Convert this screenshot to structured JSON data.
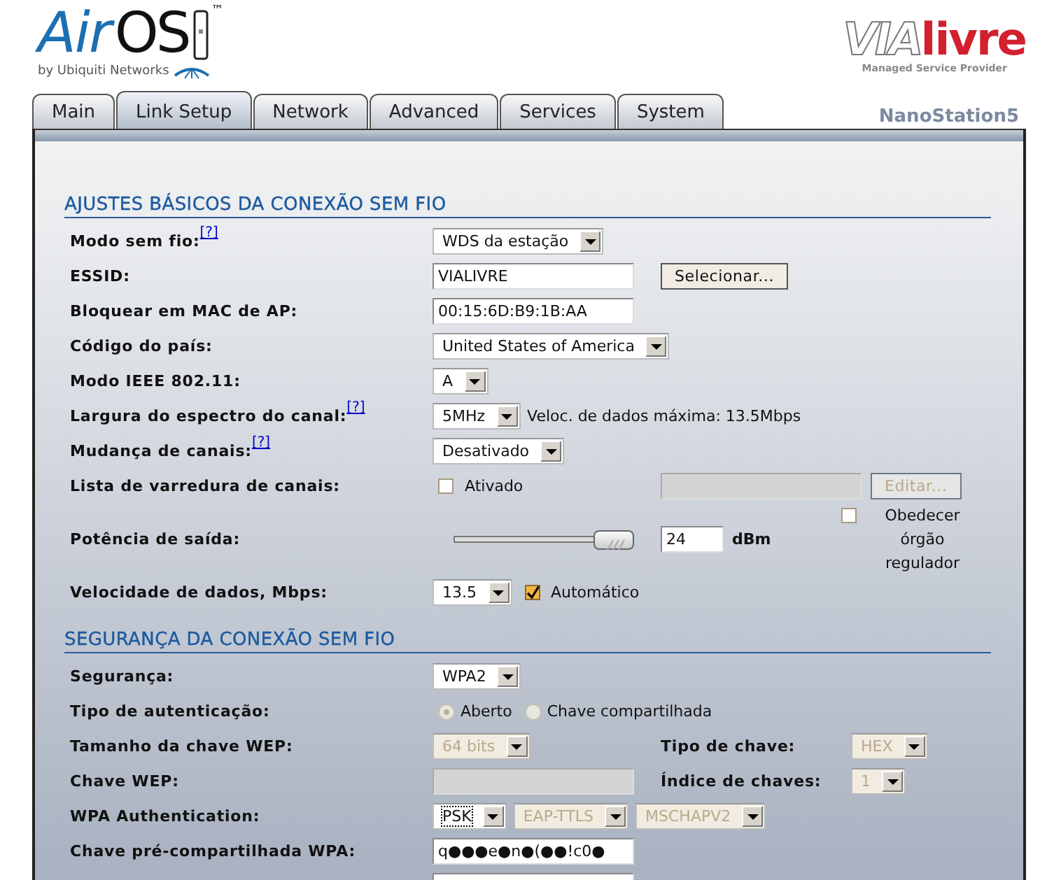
{
  "header": {
    "product_logo": {
      "name_a": "Air",
      "name_b": "OS",
      "trademark": "™",
      "tagline": "by Ubiquiti Networks"
    },
    "provider_logo": {
      "name_a": "VIA",
      "name_b": "livre",
      "tagline": "Managed Service Provider"
    }
  },
  "tabs": [
    {
      "label": "Main",
      "selected": false
    },
    {
      "label": "Link Setup",
      "selected": true
    },
    {
      "label": "Network",
      "selected": false
    },
    {
      "label": "Advanced",
      "selected": false
    },
    {
      "label": "Services",
      "selected": false
    },
    {
      "label": "System",
      "selected": false
    }
  ],
  "device_name": "NanoStation5",
  "sections": [
    {
      "title": "AJUSTES BÁSICOS DA CONEXÃO SEM FIO",
      "rows": [
        {
          "label": "Modo sem fio:",
          "help": "[?]",
          "controls": [
            {
              "kind": "select",
              "value": "WDS da estação",
              "disabled": false
            }
          ]
        },
        {
          "label": "ESSID:",
          "controls": [
            {
              "kind": "input",
              "value": "VIALIVRE",
              "disabled": false
            }
          ],
          "side": [
            {
              "kind": "button",
              "label": "Selecionar...",
              "disabled": false
            }
          ]
        },
        {
          "label": "Bloquear em MAC de AP:",
          "controls": [
            {
              "kind": "input",
              "value": "00:15:6D:B9:1B:AA",
              "disabled": false
            }
          ]
        },
        {
          "label": "Código do país:",
          "controls": [
            {
              "kind": "select",
              "value": "United States of America",
              "disabled": false
            }
          ]
        },
        {
          "label": "Modo IEEE 802.11:",
          "controls": [
            {
              "kind": "select",
              "value": "A",
              "disabled": false
            }
          ]
        },
        {
          "label": "Largura do espectro do canal:",
          "help": "[?]",
          "controls": [
            {
              "kind": "select",
              "value": "5MHz",
              "disabled": false
            },
            {
              "kind": "text",
              "text": "Veloc. de dados máxima: 13.5Mbps"
            }
          ]
        },
        {
          "label": "Mudança de canais:",
          "help": "[?]",
          "controls": [
            {
              "kind": "select",
              "value": "Desativado",
              "disabled": false
            }
          ]
        },
        {
          "label": "Lista de varredura de canais:",
          "controls": [
            {
              "kind": "checkbox",
              "label": "Ativado",
              "checked": false
            }
          ],
          "side": [
            {
              "kind": "input",
              "disabled": true
            },
            {
              "kind": "button",
              "label": "Editar...",
              "disabled": true
            }
          ]
        },
        {
          "label": "Potência de saída:",
          "controls": [
            {
              "kind": "slider",
              "level": 1
            }
          ],
          "side": [
            {
              "kind": "short-input",
              "value": "24",
              "disabled": false
            },
            {
              "kind": "unit",
              "text": "dBm"
            },
            {
              "kind": "wrap-checkbox",
              "label": "Obedecer órgão regulador",
              "checked": false
            }
          ]
        },
        {
          "label": "Velocidade de dados, Mbps:",
          "controls": [
            {
              "kind": "select",
              "value": "13.5",
              "disabled": false
            },
            {
              "kind": "checkbox",
              "label": "Automático",
              "checked": true
            }
          ]
        }
      ]
    },
    {
      "title": "SEGURANÇA DA CONEXÃO SEM FIO",
      "rows": [
        {
          "label": "Segurança:",
          "controls": [
            {
              "kind": "select",
              "value": "WPA2",
              "disabled": false
            }
          ]
        },
        {
          "label": "Tipo de autenticação:",
          "controls": [
            {
              "kind": "radio",
              "label": "Aberto",
              "selected": true,
              "disabled": true
            },
            {
              "kind": "radio",
              "label": "Chave compartilhada",
              "selected": false,
              "disabled": true
            }
          ]
        },
        {
          "label": "Tamanho da chave WEP:",
          "controls": [
            {
              "kind": "select",
              "value": "64 bits",
              "disabled": true
            }
          ],
          "side": [
            {
              "kind": "side-label",
              "text": "Tipo de chave:"
            },
            {
              "kind": "select",
              "value": "HEX",
              "disabled": true
            }
          ]
        },
        {
          "label": "Chave WEP:",
          "controls": [
            {
              "kind": "input",
              "disabled": true
            }
          ],
          "side": [
            {
              "kind": "side-label",
              "text": "Índice de chaves:"
            },
            {
              "kind": "select",
              "value": "1",
              "disabled": true
            }
          ]
        },
        {
          "label": "WPA Authentication:",
          "controls": [
            {
              "kind": "select",
              "value": "PSK",
              "disabled": false,
              "focused": true
            },
            {
              "kind": "select",
              "value": "EAP-TTLS",
              "disabled": true
            },
            {
              "kind": "select",
              "value": "MSCHAPV2",
              "disabled": true
            }
          ]
        },
        {
          "label": "Chave pré-compartilhada WPA:",
          "controls": [
            {
              "kind": "input",
              "value": "q●●●e●n●(●●!c0●",
              "disabled": false
            }
          ]
        },
        {
          "controls": [
            {
              "kind": "input"
            }
          ]
        }
      ]
    }
  ]
}
